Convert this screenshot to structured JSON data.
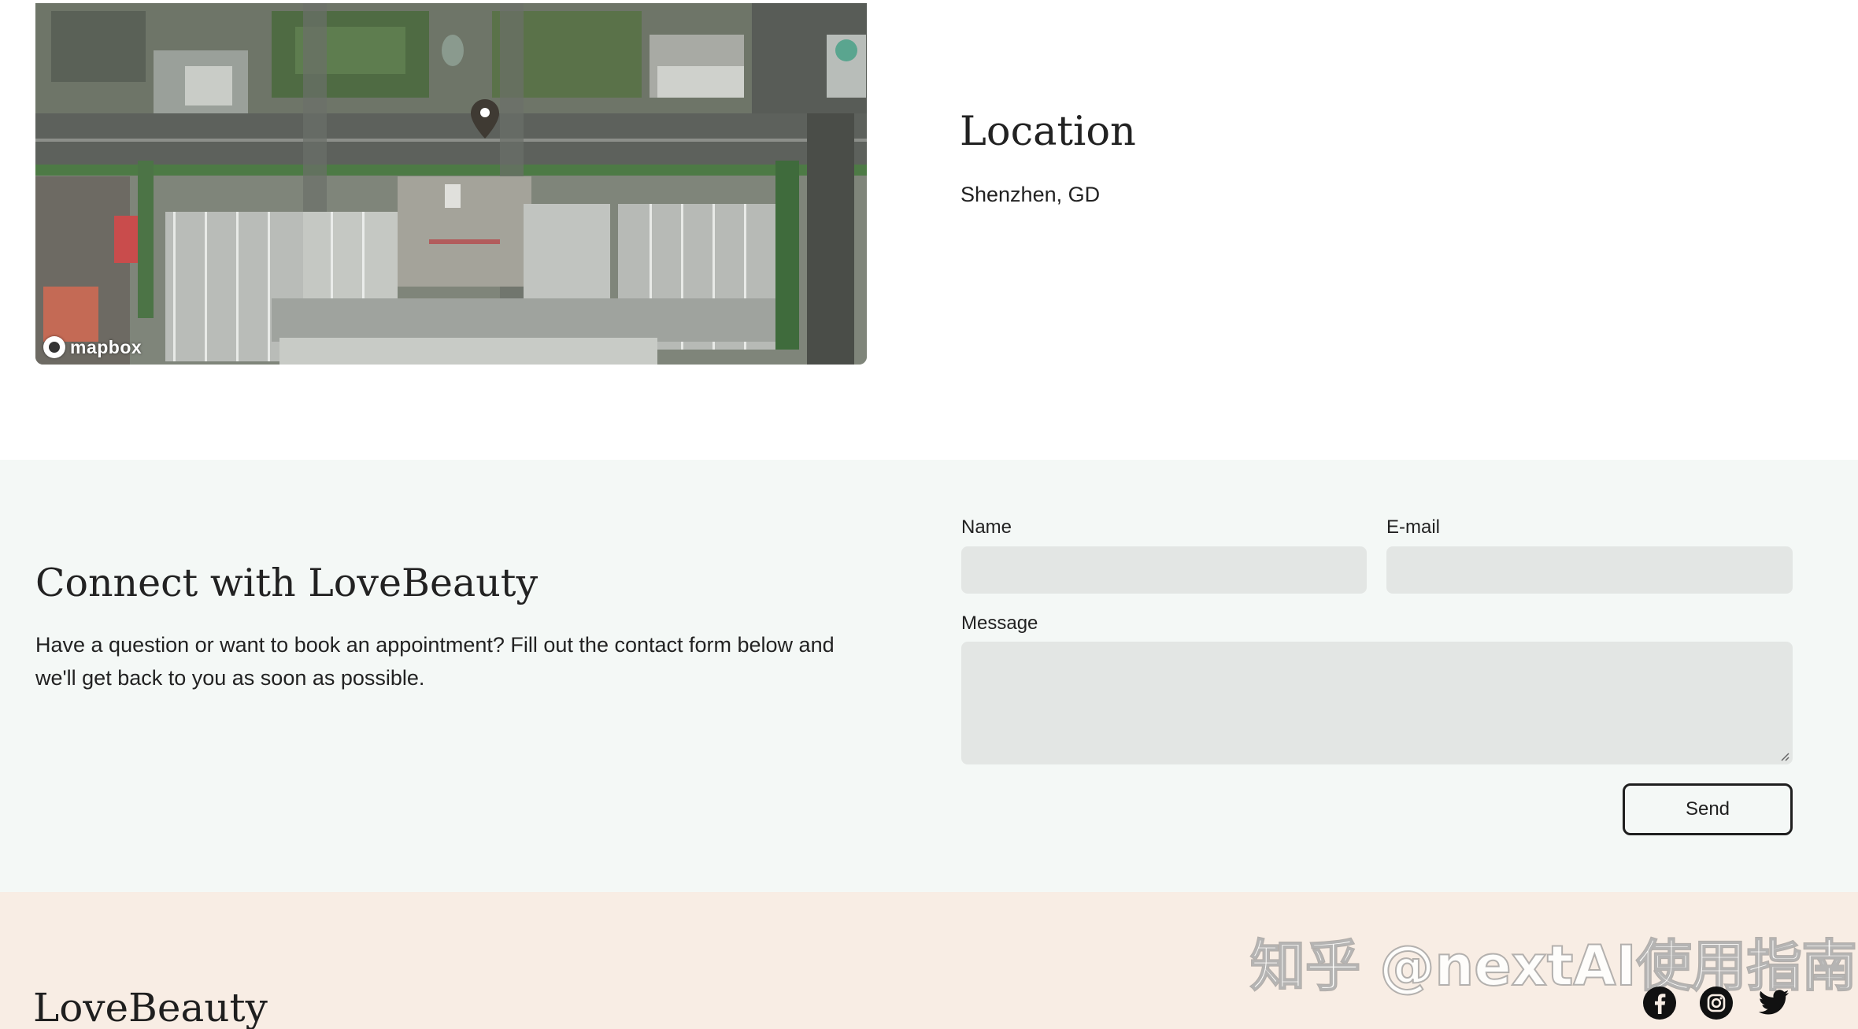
{
  "location": {
    "title": "Location",
    "address": "Shenzhen, GD",
    "map_attribution": "mapbox"
  },
  "contact": {
    "title": "Connect with LoveBeauty",
    "description": "Have a question or want to book an appointment? Fill out the contact form below and we'll get back to you as soon as possible.",
    "form": {
      "name_label": "Name",
      "email_label": "E-mail",
      "message_label": "Message",
      "send_label": "Send"
    }
  },
  "footer": {
    "brand": "LoveBeauty",
    "social": [
      "facebook-icon",
      "instagram-icon",
      "twitter-icon"
    ],
    "watermark": "知乎 @nextAI使用指南"
  },
  "colors": {
    "contact_bg": "#f4f8f6",
    "footer_bg": "#f8ede4",
    "field_bg": "#e3e6e4"
  }
}
